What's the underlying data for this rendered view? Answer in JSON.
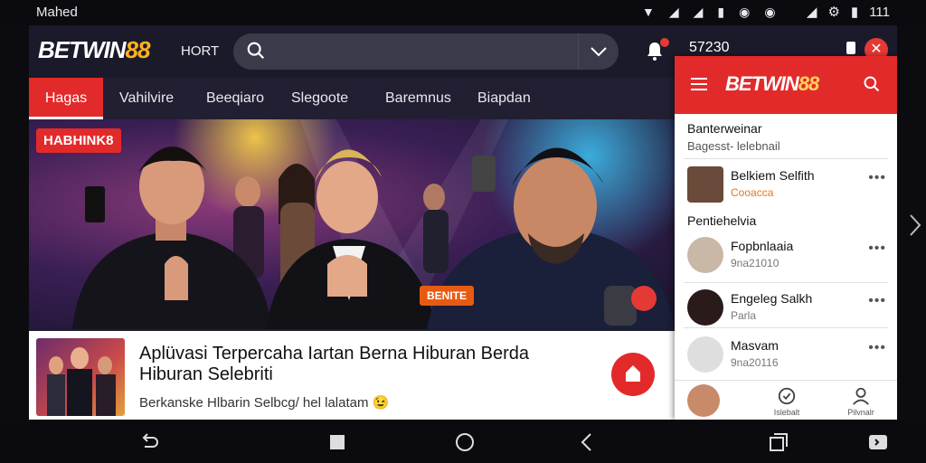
{
  "status_bar": {
    "left_text": "Mahed",
    "right_text": "111"
  },
  "header": {
    "logo_main": "BETWIN",
    "logo_accent": "88",
    "hort_label": "HORT",
    "balance": "57230",
    "notification_color": "#e53935"
  },
  "tabs": [
    {
      "label": "Hagas"
    },
    {
      "label": "Vahilvire"
    },
    {
      "label": "Beeqiaro"
    },
    {
      "label": "Slegoote"
    },
    {
      "label": "Baremnus"
    },
    {
      "label": "Biapdan"
    }
  ],
  "hero": {
    "badge": "HABHINK8",
    "sticker": "BENITE"
  },
  "article": {
    "title": "Aplüvasi Terpercaha Iartan Berna Hiburan Berda Hiburan Selebriti",
    "subtitle": "Berkanske Hlbarin Selbcg/ hel lalatam 😉"
  },
  "panel": {
    "logo_main": "BETWIN",
    "logo_accent": "88",
    "section1_title": "Banterweinar",
    "section1_sub": "Bagesst- lelebnail",
    "item1": {
      "name": "Belkiem Selfith",
      "meta": "Cooacca"
    },
    "section2_title": "Pentiehelvia",
    "items": [
      {
        "name": "Fopbnlaaia",
        "meta": "9na21010"
      },
      {
        "name": "Engeleg Salkh",
        "meta": "Parla"
      },
      {
        "name": "Masvam",
        "meta": "9na20116"
      }
    ],
    "bottom_nav": [
      {
        "label": "Islebalt"
      },
      {
        "label": "Pilvnalr"
      }
    ]
  },
  "colors": {
    "brand_red": "#e32a2a",
    "accent_yellow": "#ffb21e",
    "topbar": "#1b1a2a"
  }
}
